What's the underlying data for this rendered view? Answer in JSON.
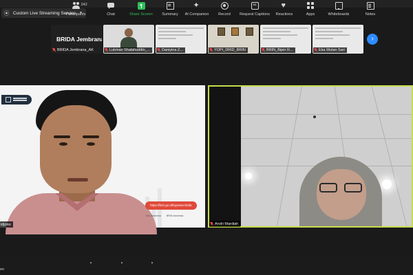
{
  "stream": {
    "label": "Custom Live Streaming Service",
    "icon": "live-stream-icon"
  },
  "thumbnails": [
    {
      "name": "BRIDA Jembrana_AK",
      "tile_text": "BRIDA Jembrana_...",
      "muted": true
    },
    {
      "name": "Lukman Shalahuddin_...",
      "muted": true
    },
    {
      "name": "Daniyina Z...",
      "muted": true
    },
    {
      "name": "YOPI_DRID_BRIN",
      "muted": true
    },
    {
      "name": "BRIN_Bipin R...",
      "muted": true
    },
    {
      "name": "Eka Wulan Sari",
      "muted": true
    }
  ],
  "main": {
    "left_name": "idjono",
    "right_name": "Andri Mardiah",
    "slide_url": "https://brin.go.id/layanan-brida",
    "slide_socials": [
      "brin.indonesia",
      "BRIN Indonesia"
    ],
    "active_speaker_color": "#c7dd4c"
  },
  "toolbar": {
    "left_cut": "eo",
    "participants_count": "242",
    "participants": "Participants",
    "chat": "Chat",
    "share": "Share Screen",
    "summary": "Summary",
    "ai": "AI Companion",
    "record": "Record",
    "captions": "Request Captions",
    "reactions": "Reactions",
    "apps": "Apps",
    "whiteboards": "Whiteboards",
    "notes": "Notes",
    "accent_green": "#2fbf5a"
  }
}
